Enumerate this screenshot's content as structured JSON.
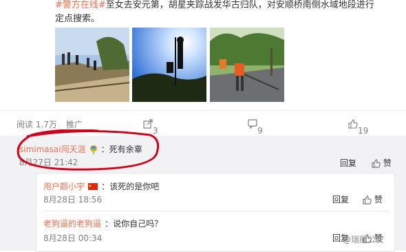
{
  "post": {
    "line1_link": "#警方在线#",
    "line1_text": "至女去安元第，胡星夹踪战发华古归队，对安顺桥南侧水域地段进行",
    "line2": "定点搜索。"
  },
  "stats": {
    "read_label": "阅读 1.7万",
    "promote_label": "推广",
    "share_count": "3",
    "comment_count": "9",
    "like_count": "19"
  },
  "comments": [
    {
      "user": "simimasai闯天涯",
      "badge": "rainbow-balloon-icon",
      "text": "：死有余辜",
      "time": "8月27日 21:42",
      "reply_label": "回复",
      "like_label": "赞"
    }
  ],
  "replies": [
    {
      "user": "用户颜小宇",
      "badge": "china-flag-icon",
      "text": "：该死的是你吧",
      "time": "8月28日 18:56",
      "reply_label": "回复",
      "like_label": "赞"
    },
    {
      "user": "老狗逼的老狗逼",
      "text": "：说你自己吗？",
      "time": "8月28日 00:34",
      "reply_label": "回复",
      "like_label": "赞"
    }
  ],
  "watermark": "@瑞丽公安",
  "colors": {
    "username": "#eb7350",
    "highlight_circle": "#d0021b",
    "comment_bg": "#f2f2f5"
  }
}
